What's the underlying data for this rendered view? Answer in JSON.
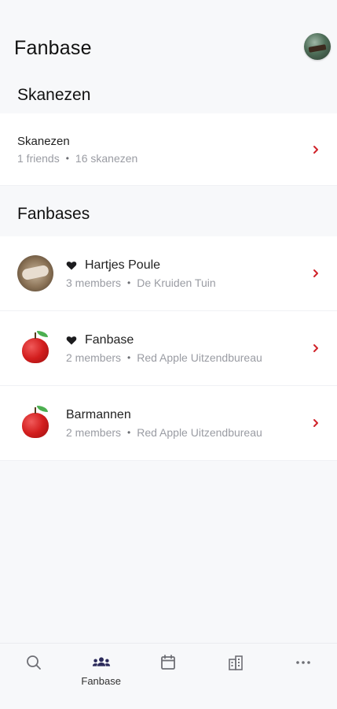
{
  "header": {
    "title": "Fanbase"
  },
  "skanezen_section": {
    "title": "Skanezen",
    "item": {
      "title": "Skanezen",
      "meta_left": "1 friends",
      "meta_right": "16 skanezen"
    }
  },
  "fanbases_section": {
    "title": "Fanbases",
    "items": [
      {
        "title": "Hartjes Poule",
        "favorite": true,
        "members": "3 members",
        "org": "De Kruiden Tuin",
        "thumb": "photo"
      },
      {
        "title": "Fanbase",
        "favorite": true,
        "members": "2 members",
        "org": "Red Apple Uitzendbureau",
        "thumb": "apple"
      },
      {
        "title": "Barmannen",
        "favorite": false,
        "members": "2 members",
        "org": "Red Apple Uitzendbureau",
        "thumb": "apple"
      }
    ]
  },
  "bottom_nav": {
    "items": [
      {
        "icon": "search-icon",
        "label": ""
      },
      {
        "icon": "people-icon",
        "label": "Fanbase",
        "active": true
      },
      {
        "icon": "calendar-icon",
        "label": ""
      },
      {
        "icon": "buildings-icon",
        "label": ""
      },
      {
        "icon": "more-icon",
        "label": ""
      }
    ]
  },
  "colors": {
    "accent": "#d0232a",
    "nav_active": "#2b2a5a",
    "muted_text": "#9a9ca3",
    "background": "#f7f8fa"
  }
}
